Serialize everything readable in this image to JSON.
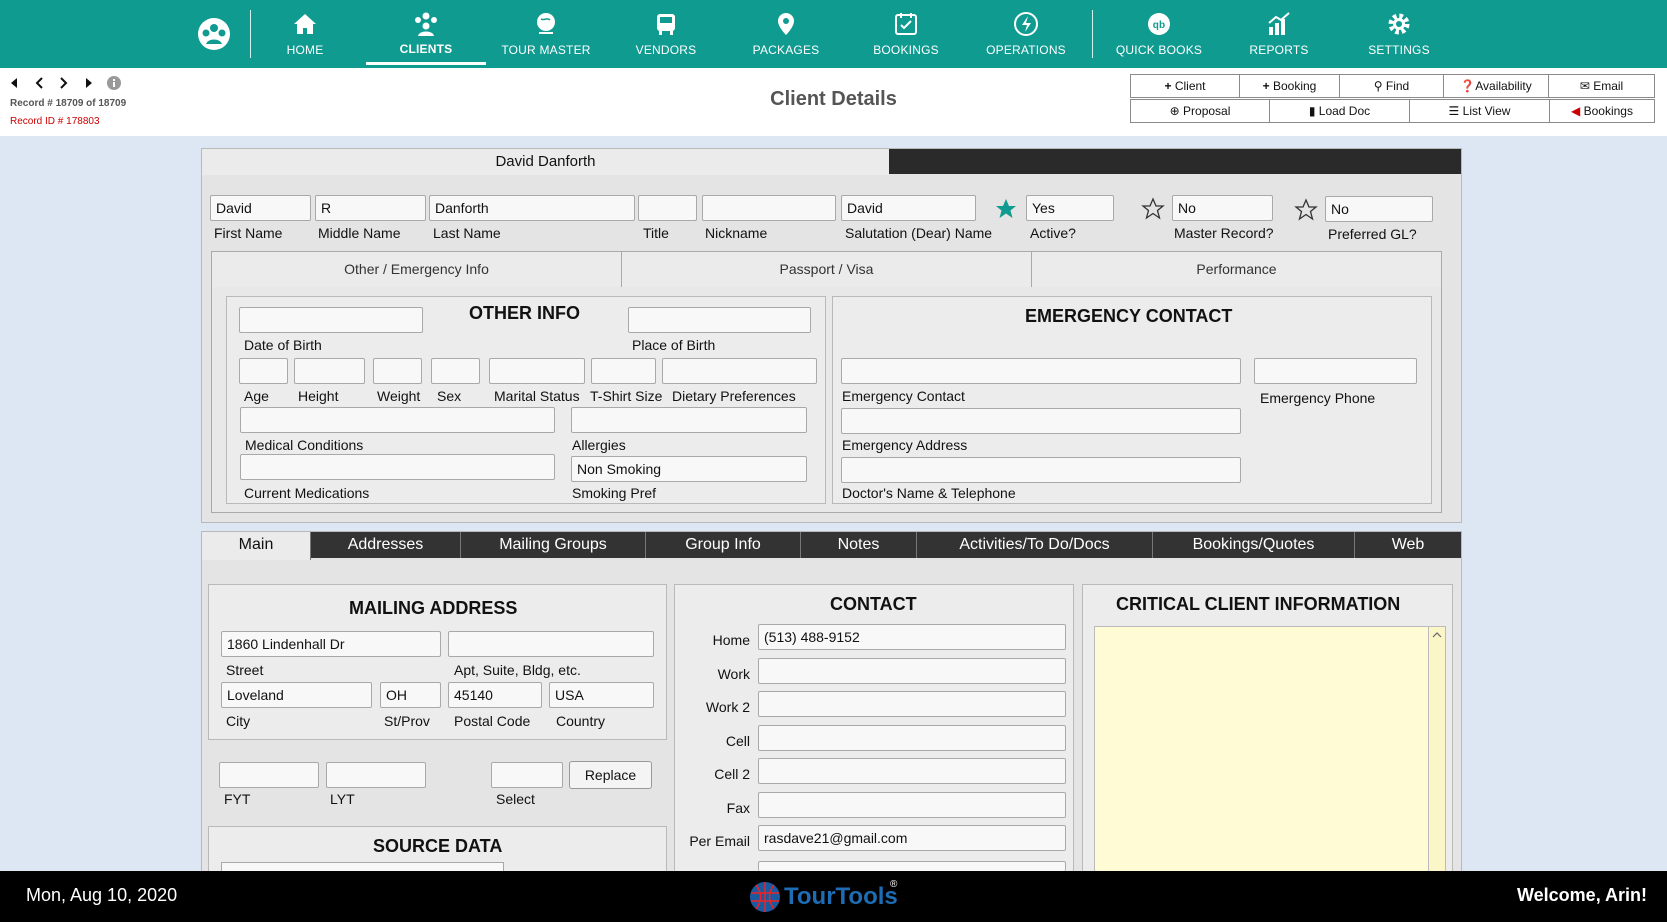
{
  "nav": {
    "items": [
      {
        "label": "HOME",
        "icon": "home-icon"
      },
      {
        "label": "CLIENTS",
        "icon": "clients-icon"
      },
      {
        "label": "TOUR MASTER",
        "icon": "globe-icon"
      },
      {
        "label": "VENDORS",
        "icon": "bus-icon"
      },
      {
        "label": "PACKAGES",
        "icon": "location-pin-icon"
      },
      {
        "label": "BOOKINGS",
        "icon": "calendar-icon"
      },
      {
        "label": "OPERATIONS",
        "icon": "operations-icon"
      },
      {
        "label": "QUICK BOOKS",
        "icon": "quickbooks-icon"
      },
      {
        "label": "REPORTS",
        "icon": "chart-icon"
      },
      {
        "label": "SETTINGS",
        "icon": "gear-icon"
      }
    ],
    "active": "CLIENTS",
    "bg": "#109b91"
  },
  "header": {
    "record_count": "Record # 18709 of 18709",
    "record_id": "Record ID # 178803",
    "title": "Client Details"
  },
  "toolbar": {
    "row1": [
      "Client",
      "Booking",
      "Find",
      "Availability",
      "Email"
    ],
    "row2": [
      "Proposal",
      "Load Doc",
      "List View",
      "Bookings"
    ]
  },
  "client": {
    "tab_name": "David Danforth",
    "first_name": "David",
    "middle_name": "R",
    "last_name": "Danforth",
    "title": "",
    "nickname": "",
    "salutation": "David",
    "active": "Yes",
    "master_record": "No",
    "preferred_gl": "No",
    "labels": {
      "first_name": "First Name",
      "middle_name": "Middle Name",
      "last_name": "Last Name",
      "title": "Title",
      "nickname": "Nickname",
      "salutation": "Salutation (Dear) Name",
      "active": "Active?",
      "master_record": "Master Record?",
      "preferred_gl": "Preferred GL?"
    }
  },
  "subtabs": [
    "Other / Emergency Info",
    "Passport / Visa",
    "Performance"
  ],
  "other_info": {
    "heading": "OTHER INFO",
    "labels": {
      "dob": "Date of Birth",
      "pob": "Place of Birth",
      "age": "Age",
      "height": "Height",
      "weight": "Weight",
      "sex": "Sex",
      "marital": "Marital Status",
      "tshirt": "T-Shirt Size",
      "dietary": "Dietary Preferences",
      "medical": "Medical Conditions",
      "allergies": "Allergies",
      "medications": "Current Medications",
      "smoking": "Smoking Pref"
    },
    "smoking_value": "Non Smoking"
  },
  "emergency": {
    "heading": "EMERGENCY CONTACT",
    "labels": {
      "contact": "Emergency Contact",
      "phone": "Emergency Phone",
      "address": "Emergency Address",
      "doctor": "Doctor's Name & Telephone"
    }
  },
  "maintabs": [
    "Main",
    "Addresses",
    "Mailing Groups",
    "Group Info",
    "Notes",
    "Activities/To Do/Docs",
    "Bookings/Quotes",
    "Web"
  ],
  "mailing": {
    "heading": "MAILING ADDRESS",
    "street": "1860 Lindenhall Dr",
    "apt": "",
    "city": "Loveland",
    "state": "OH",
    "postal": "45140",
    "country": "USA",
    "labels": {
      "street": "Street",
      "apt": "Apt, Suite, Bldg, etc.",
      "city": "City",
      "state": "St/Prov",
      "postal": "Postal Code",
      "country": "Country",
      "fyt": "FYT",
      "lyt": "LYT",
      "select": "Select"
    },
    "replace": "Replace"
  },
  "source": {
    "heading": "SOURCE DATA"
  },
  "contact": {
    "heading": "CONTACT",
    "rows": [
      {
        "label": "Home",
        "value": "(513) 488-9152"
      },
      {
        "label": "Work",
        "value": ""
      },
      {
        "label": "Work 2",
        "value": ""
      },
      {
        "label": "Cell",
        "value": ""
      },
      {
        "label": "Cell 2",
        "value": ""
      },
      {
        "label": "Fax",
        "value": ""
      },
      {
        "label": "Per Email",
        "value": "rasdave21@gmail.com"
      }
    ]
  },
  "critical": {
    "heading": "CRITICAL CLIENT INFORMATION",
    "value": ""
  },
  "footer": {
    "date": "Mon, Aug 10, 2020",
    "brand": "TourTools",
    "welcome": "Welcome, Arin!"
  }
}
